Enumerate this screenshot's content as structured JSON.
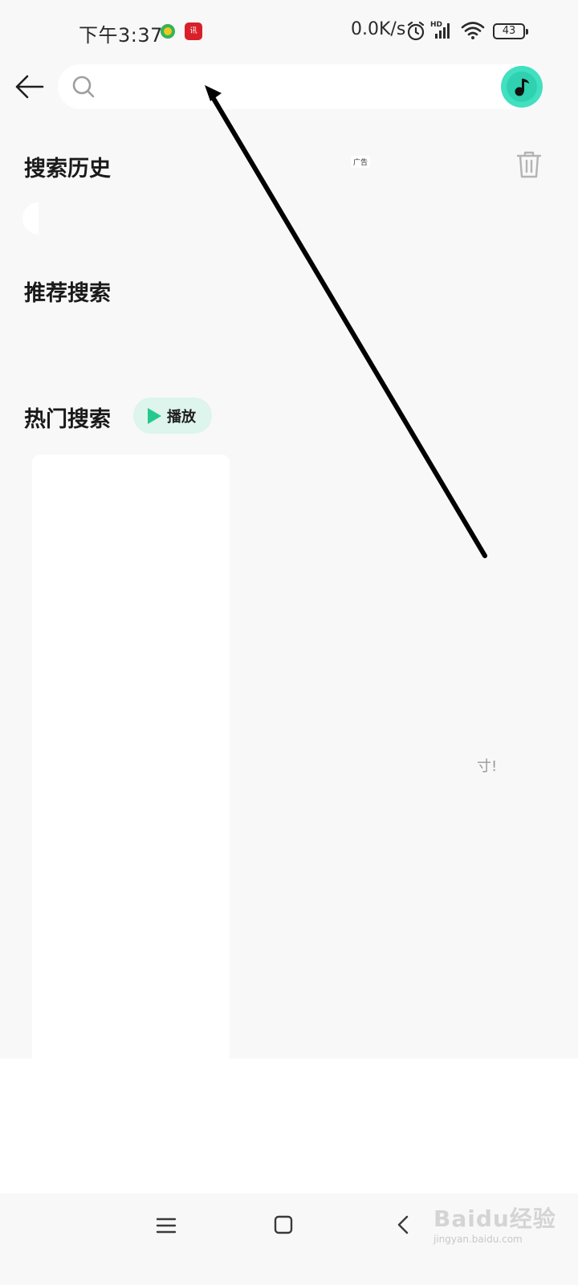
{
  "status_bar": {
    "time": "下午3:37",
    "app2_label": "讯",
    "net_speed": "0.0K/s",
    "network_label": "HD",
    "battery": "43"
  },
  "search": {
    "placeholder": "",
    "value": ""
  },
  "sections": {
    "history_title": "搜索历史",
    "ad_label": "广告",
    "recommend_title": "推荐搜索",
    "hot_title": "热门搜索",
    "play_label": "播放"
  },
  "misc": {
    "side_text": "寸!"
  },
  "watermark": {
    "main": "Baidu经验",
    "sub": "jingyan.baidu.com"
  },
  "colors": {
    "accent": "#2fd1b0",
    "play_bg": "#ddf5ec",
    "play_icon": "#25c98c",
    "background": "#f8f8f8"
  },
  "icons": {
    "back": "back-arrow-icon",
    "search": "search-icon",
    "music": "music-note-icon",
    "trash": "trash-icon",
    "play": "play-icon",
    "alarm": "alarm-icon",
    "signal": "signal-icon",
    "wifi": "wifi-icon"
  }
}
